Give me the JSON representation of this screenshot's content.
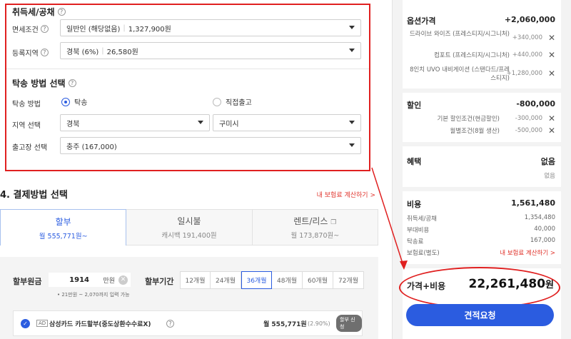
{
  "tax_section": {
    "title": "취득세/공채",
    "exemption": {
      "label": "면세조건",
      "value": "일반인 (해당없음)",
      "amount": "1,327,900원"
    },
    "region": {
      "label": "등록지역",
      "value": "경북 (6%)",
      "amount": "26,580원"
    }
  },
  "delivery_section": {
    "title": "탁송 방법 선택",
    "method_label": "탁송 방법",
    "options": [
      "탁송",
      "직접출고"
    ],
    "selected": "탁송",
    "region_label": "지역 선택",
    "region_province": "경북",
    "region_city": "구미시",
    "factory_label": "출고장 선택",
    "factory_value": "충주 (167,000)"
  },
  "payment": {
    "title": "4. 결제방법 선택",
    "insurance_link": "내 보험료 계산하기 >",
    "tabs": [
      {
        "name": "할부",
        "sub": "월 555,771원~",
        "active": true
      },
      {
        "name": "일시불",
        "sub": "캐시백 191,400원",
        "active": false
      },
      {
        "name": "렌트/리스",
        "sub": "월 173,870원~",
        "active": false
      }
    ],
    "principal_label": "할부원금",
    "principal_value": "1914",
    "principal_unit": "만원",
    "principal_hint": "• 21만원 ~ 2,070까지 입력 가능",
    "period_label": "할부기간",
    "months": [
      "12개월",
      "24개월",
      "36개월",
      "48개월",
      "60개월",
      "72개월"
    ],
    "selected_month": "36개월",
    "card": {
      "ad": "AD",
      "name": "삼성카드 카드할부(중도상환수수료X)",
      "amount": "월 555,771원",
      "rate": "(2.90%)",
      "button": "할부 신청"
    }
  },
  "summary": {
    "option_label": "옵션가격",
    "option_total": "+2,060,000",
    "options": [
      {
        "name": "드라이브 와이즈 (프레스티지/시그니처)",
        "price": "+340,000"
      },
      {
        "name": "컴포트 (프레스티지/시그니처)",
        "price": "+440,000"
      },
      {
        "name": "8인치 UVO 내비게이션 (스탠다드/프레스티지)",
        "price": "+1,280,000"
      }
    ],
    "discount_label": "할인",
    "discount_total": "-800,000",
    "discounts": [
      {
        "name": "기본 할인조건(현금할인)",
        "price": "-300,000"
      },
      {
        "name": "월별조건(8월 생산)",
        "price": "-500,000"
      }
    ],
    "benefit_label": "혜택",
    "benefit_value": "없음",
    "benefit_sub": "없음",
    "cost_label": "비용",
    "cost_total": "1,561,480",
    "costs": [
      {
        "name": "취득세/공채",
        "price": "1,354,480"
      },
      {
        "name": "부대비용",
        "price": "40,000"
      },
      {
        "name": "탁송료",
        "price": "167,000"
      }
    ],
    "insurance_label": "보험료(별도)",
    "insurance_link": "내 보험료 계산하기 >",
    "total_label": "가격+비용",
    "total_value": "22,261,480",
    "total_unit": "원",
    "quote_button": "견적요청"
  },
  "colors": {
    "accent": "#2b5ce0",
    "highlight": "#e02020",
    "link": "#e0322a"
  }
}
